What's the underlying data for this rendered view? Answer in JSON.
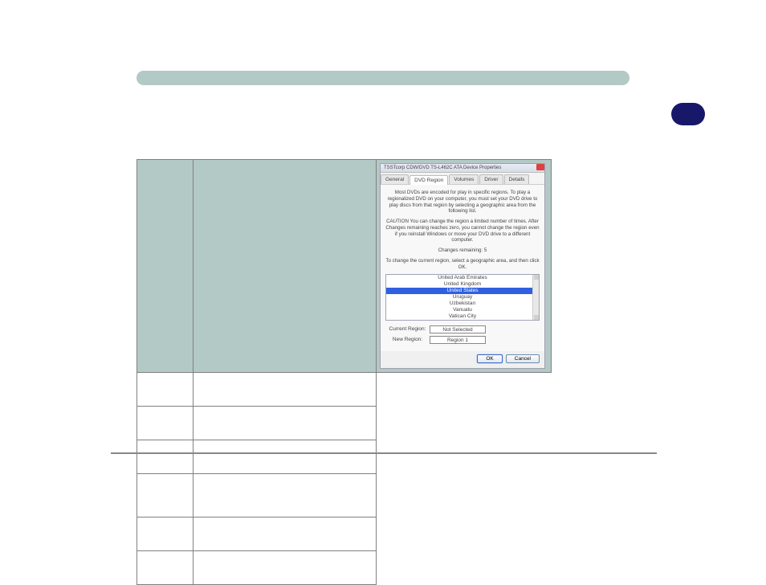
{
  "table": {
    "headers": {
      "region": "",
      "geo": ""
    },
    "rows": [
      {
        "region": "",
        "geo": ""
      },
      {
        "region": "",
        "geo": ""
      },
      {
        "region": "",
        "geo": ""
      },
      {
        "region": "",
        "geo": ""
      },
      {
        "region": "",
        "geo": ""
      },
      {
        "region": "",
        "geo": ""
      }
    ]
  },
  "dialog": {
    "title": "TSSTcorp CDW/DVD TS-L462C ATA Device Properties",
    "tabs": {
      "general": "General",
      "dvd_region": "DVD Region",
      "volumes": "Volumes",
      "driver": "Driver",
      "details": "Details"
    },
    "body": {
      "p1": "Most DVDs are encoded for play in specific regions. To play a regionalized DVD on your computer, you must set your DVD drive to play discs from that region by selecting a geographic area from the following list.",
      "p2": "CAUTION  You can change the region a limited number of times. After Changes remaining reaches zero, you cannot change the region even if you reinstall Windows or move your DVD drive to a different computer.",
      "p3_label": "Changes remaining:",
      "p3_value": "5",
      "p4": "To change the current region, select a geographic area, and then click OK."
    },
    "list": [
      "United Arab Emirates",
      "United Kingdom",
      "United States",
      "Uruguay",
      "Uzbekistan",
      "Vanuatu",
      "Vatican City"
    ],
    "selected_index": 2,
    "current_region_label": "Current Region:",
    "current_region_value": "Not Selected",
    "new_region_label": "New Region:",
    "new_region_value": "Region 1",
    "ok": "OK",
    "cancel": "Cancel"
  }
}
